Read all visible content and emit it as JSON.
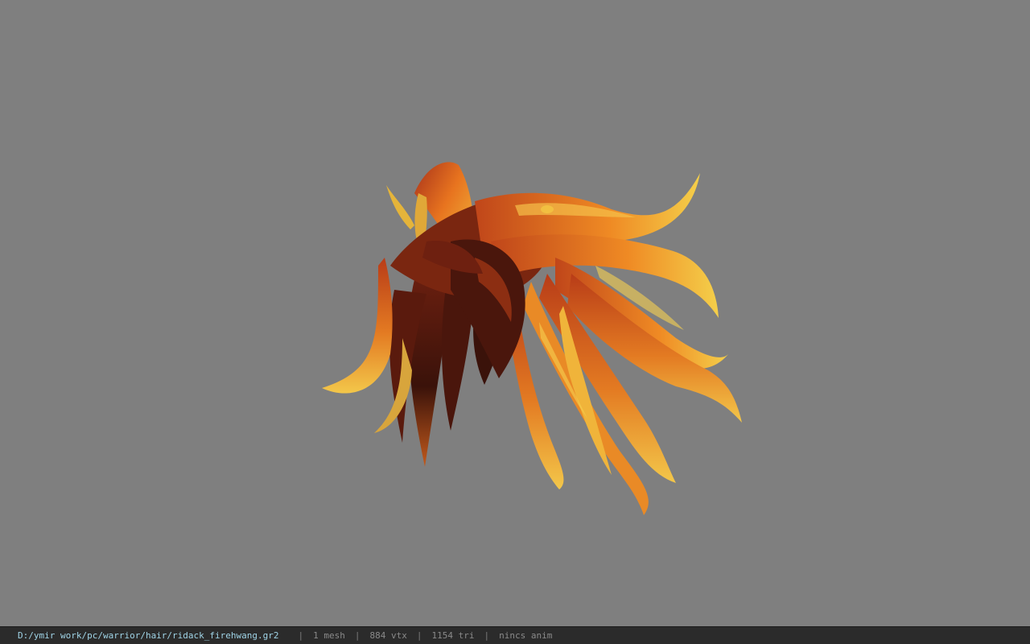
{
  "viewport": {
    "background": "#7f7f7f",
    "model": {
      "description_name": "hair-model",
      "colors": {
        "dark": "#3a120a",
        "mid_dark": "#6e2010",
        "mid": "#c0461a",
        "bright": "#ef8a24",
        "tip": "#f2c542"
      }
    }
  },
  "status_bar": {
    "file_path": "D:/ymir work/pc/warrior/hair/ridack_firehwang.gr2",
    "separator": "|",
    "mesh_count": "1 mesh",
    "vertex_count": "884 vtx",
    "triangle_count": "1154 tri",
    "anim_status": "nincs anim"
  }
}
